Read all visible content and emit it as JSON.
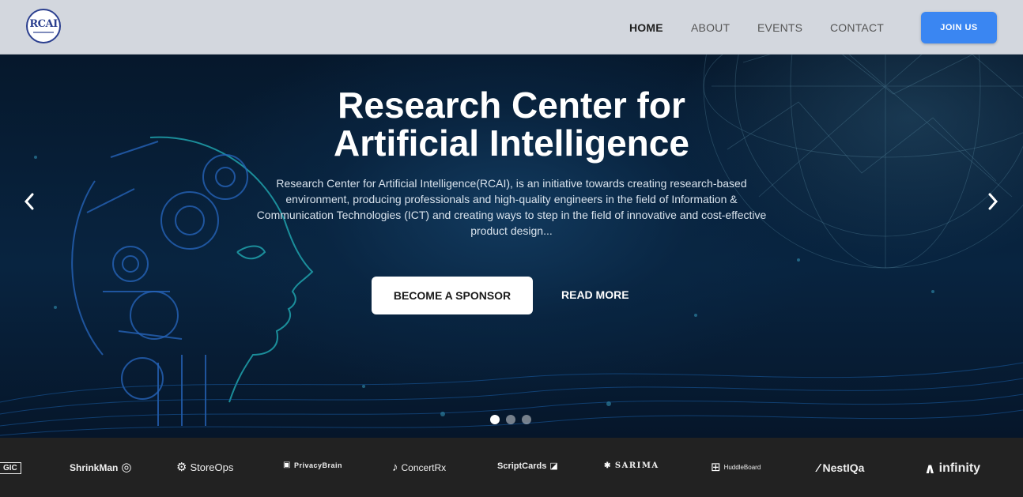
{
  "nav": {
    "logo_text": "RCAI",
    "links": [
      "HOME",
      "ABOUT",
      "EVENTS",
      "CONTACT"
    ],
    "active": "HOME",
    "cta": "JOIN US",
    "cta_color": "#3a86f2"
  },
  "hero": {
    "title_line1": "Research Center for",
    "title_line2": "Artificial Intelligence",
    "description": "Research Center for Artificial Intelligence(RCAI), is an initiative towards creating research-based environment, producing professionals and high-quality engineers in the field of Information & Communication Technologies (ICT) and creating ways to step in the field of innovative and cost-effective product design...",
    "primary_button": "BECOME A SPONSOR",
    "secondary_button": "READ MORE",
    "prev_icon": "chevron-left-icon",
    "next_icon": "chevron-right-icon",
    "slides": 3,
    "active_slide": 1
  },
  "sponsors": {
    "items": [
      {
        "name": "GIC"
      },
      {
        "name": "ShrinkMan"
      },
      {
        "name": "StoreOps"
      },
      {
        "name": "PrivacyBrain"
      },
      {
        "name": "ConcertRx"
      },
      {
        "name": "ScriptCards"
      },
      {
        "name": "SARIMA"
      },
      {
        "name": "HuddleBoard"
      },
      {
        "name": "NestIQa"
      },
      {
        "name": "infinity"
      }
    ]
  }
}
